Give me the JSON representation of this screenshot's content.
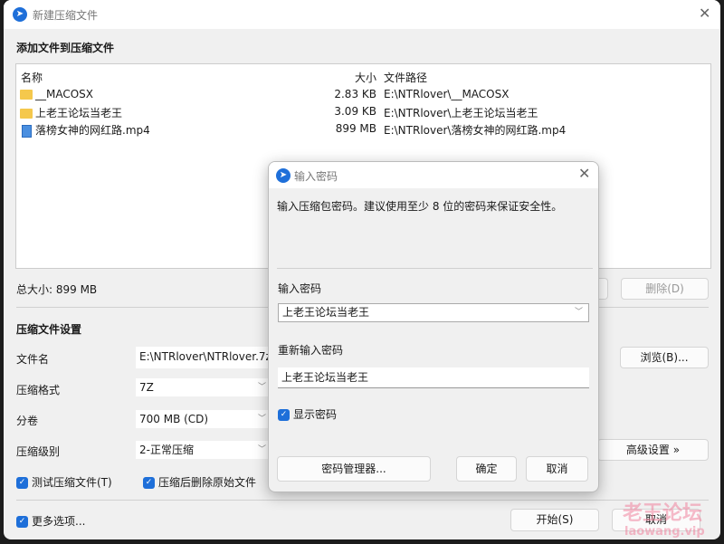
{
  "main": {
    "title": "新建压缩文件",
    "section_add": "添加文件到压缩文件",
    "columns": {
      "name": "名称",
      "size": "大小",
      "path": "文件路径"
    },
    "files": [
      {
        "name": "__MACOSX",
        "size": "2.83 KB",
        "path": "E:\\NTRlover\\__MACOSX",
        "icon": "folder-icon"
      },
      {
        "name": "上老王论坛当老王",
        "size": "3.09 KB",
        "path": "E:\\NTRlover\\上老王论坛当老王",
        "icon": "folder-icon"
      },
      {
        "name": "落榜女神的网红路.mp4",
        "size": "899 MB",
        "path": "E:\\NTRlover\\落榜女神的网红路.mp4",
        "icon": "video-file-icon"
      }
    ],
    "total_size": "总大小: 899 MB",
    "delete_label": "删除(D)",
    "settings_heading": "压缩文件设置",
    "filename_label": "文件名",
    "filename_value": "E:\\NTRlover\\NTRlover.7z",
    "browse_label": "浏览(B)...",
    "format_label": "压缩格式",
    "format_value": "7Z",
    "split_label": "分卷",
    "split_value": "700 MB (CD)",
    "level_label": "压缩级别",
    "level_value": "2-正常压缩",
    "advanced_label": "高级设置 »",
    "test_label": "测试压缩文件(T)",
    "delete_after_label": "压缩后删除原始文件",
    "more_options_label": "更多选项...",
    "start_label": "开始(S)",
    "cancel_label": "取消"
  },
  "dialog": {
    "title": "输入密码",
    "hint": "输入压缩包密码。建议使用至少 8 位的密码来保证安全性。",
    "password_label": "输入密码",
    "password_value": "上老王论坛当老王",
    "reenter_label": "重新输入密码",
    "reenter_value": "上老王论坛当老王",
    "show_password_label": "显示密码",
    "manager_label": "密码管理器...",
    "ok_label": "确定",
    "cancel_label": "取消"
  },
  "watermark": {
    "line1": "老王论坛",
    "line2": "laowang.vip"
  },
  "colors": {
    "accent": "#1e6fd9"
  }
}
